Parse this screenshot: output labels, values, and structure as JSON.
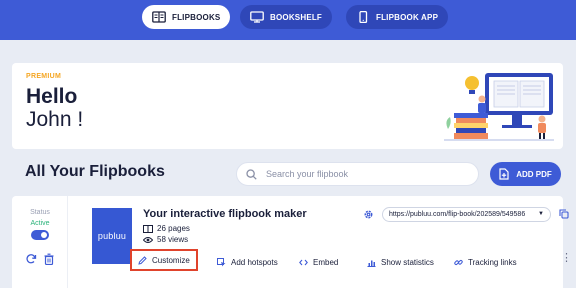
{
  "nav": {
    "items": [
      {
        "label": "FLIPBOOKS",
        "active": true
      },
      {
        "label": "BOOKSHELF",
        "active": false
      },
      {
        "label": "FLIPBOOK APP",
        "active": false
      }
    ]
  },
  "hero": {
    "plan": "PREMIUM",
    "greeting": "Hello",
    "user_name": "John !"
  },
  "main": {
    "heading": "All Your Flipbooks",
    "search_placeholder": "Search your flipbook",
    "add_pdf_label": "ADD PDF"
  },
  "flipbook": {
    "status_label": "Status",
    "status_value": "Active",
    "cover_logo": "publuu",
    "title": "Your interactive flipbook maker",
    "pages": "26 pages",
    "views": "58 views",
    "url": "https://publuu.com/flip-book/202589/549586",
    "actions": {
      "customize": "Customize",
      "add_hotspots": "Add hotspots",
      "embed": "Embed",
      "show_statistics": "Show statistics",
      "tracking_links": "Tracking links"
    }
  },
  "colors": {
    "brand_blue": "#3e5bd6",
    "premium_orange": "#f5a623",
    "active_green": "#2bb37a",
    "highlight_red": "#e0432c"
  },
  "icons": [
    "flipbooks-icon",
    "bookshelf-icon",
    "phone-icon",
    "search-icon",
    "add-pdf-icon",
    "refresh-icon",
    "trash-icon",
    "book-icon",
    "eye-icon",
    "gear-icon",
    "copy-icon",
    "pencil-icon",
    "hotspot-icon",
    "code-icon",
    "stats-icon",
    "link-icon",
    "more-vertical-icon"
  ]
}
